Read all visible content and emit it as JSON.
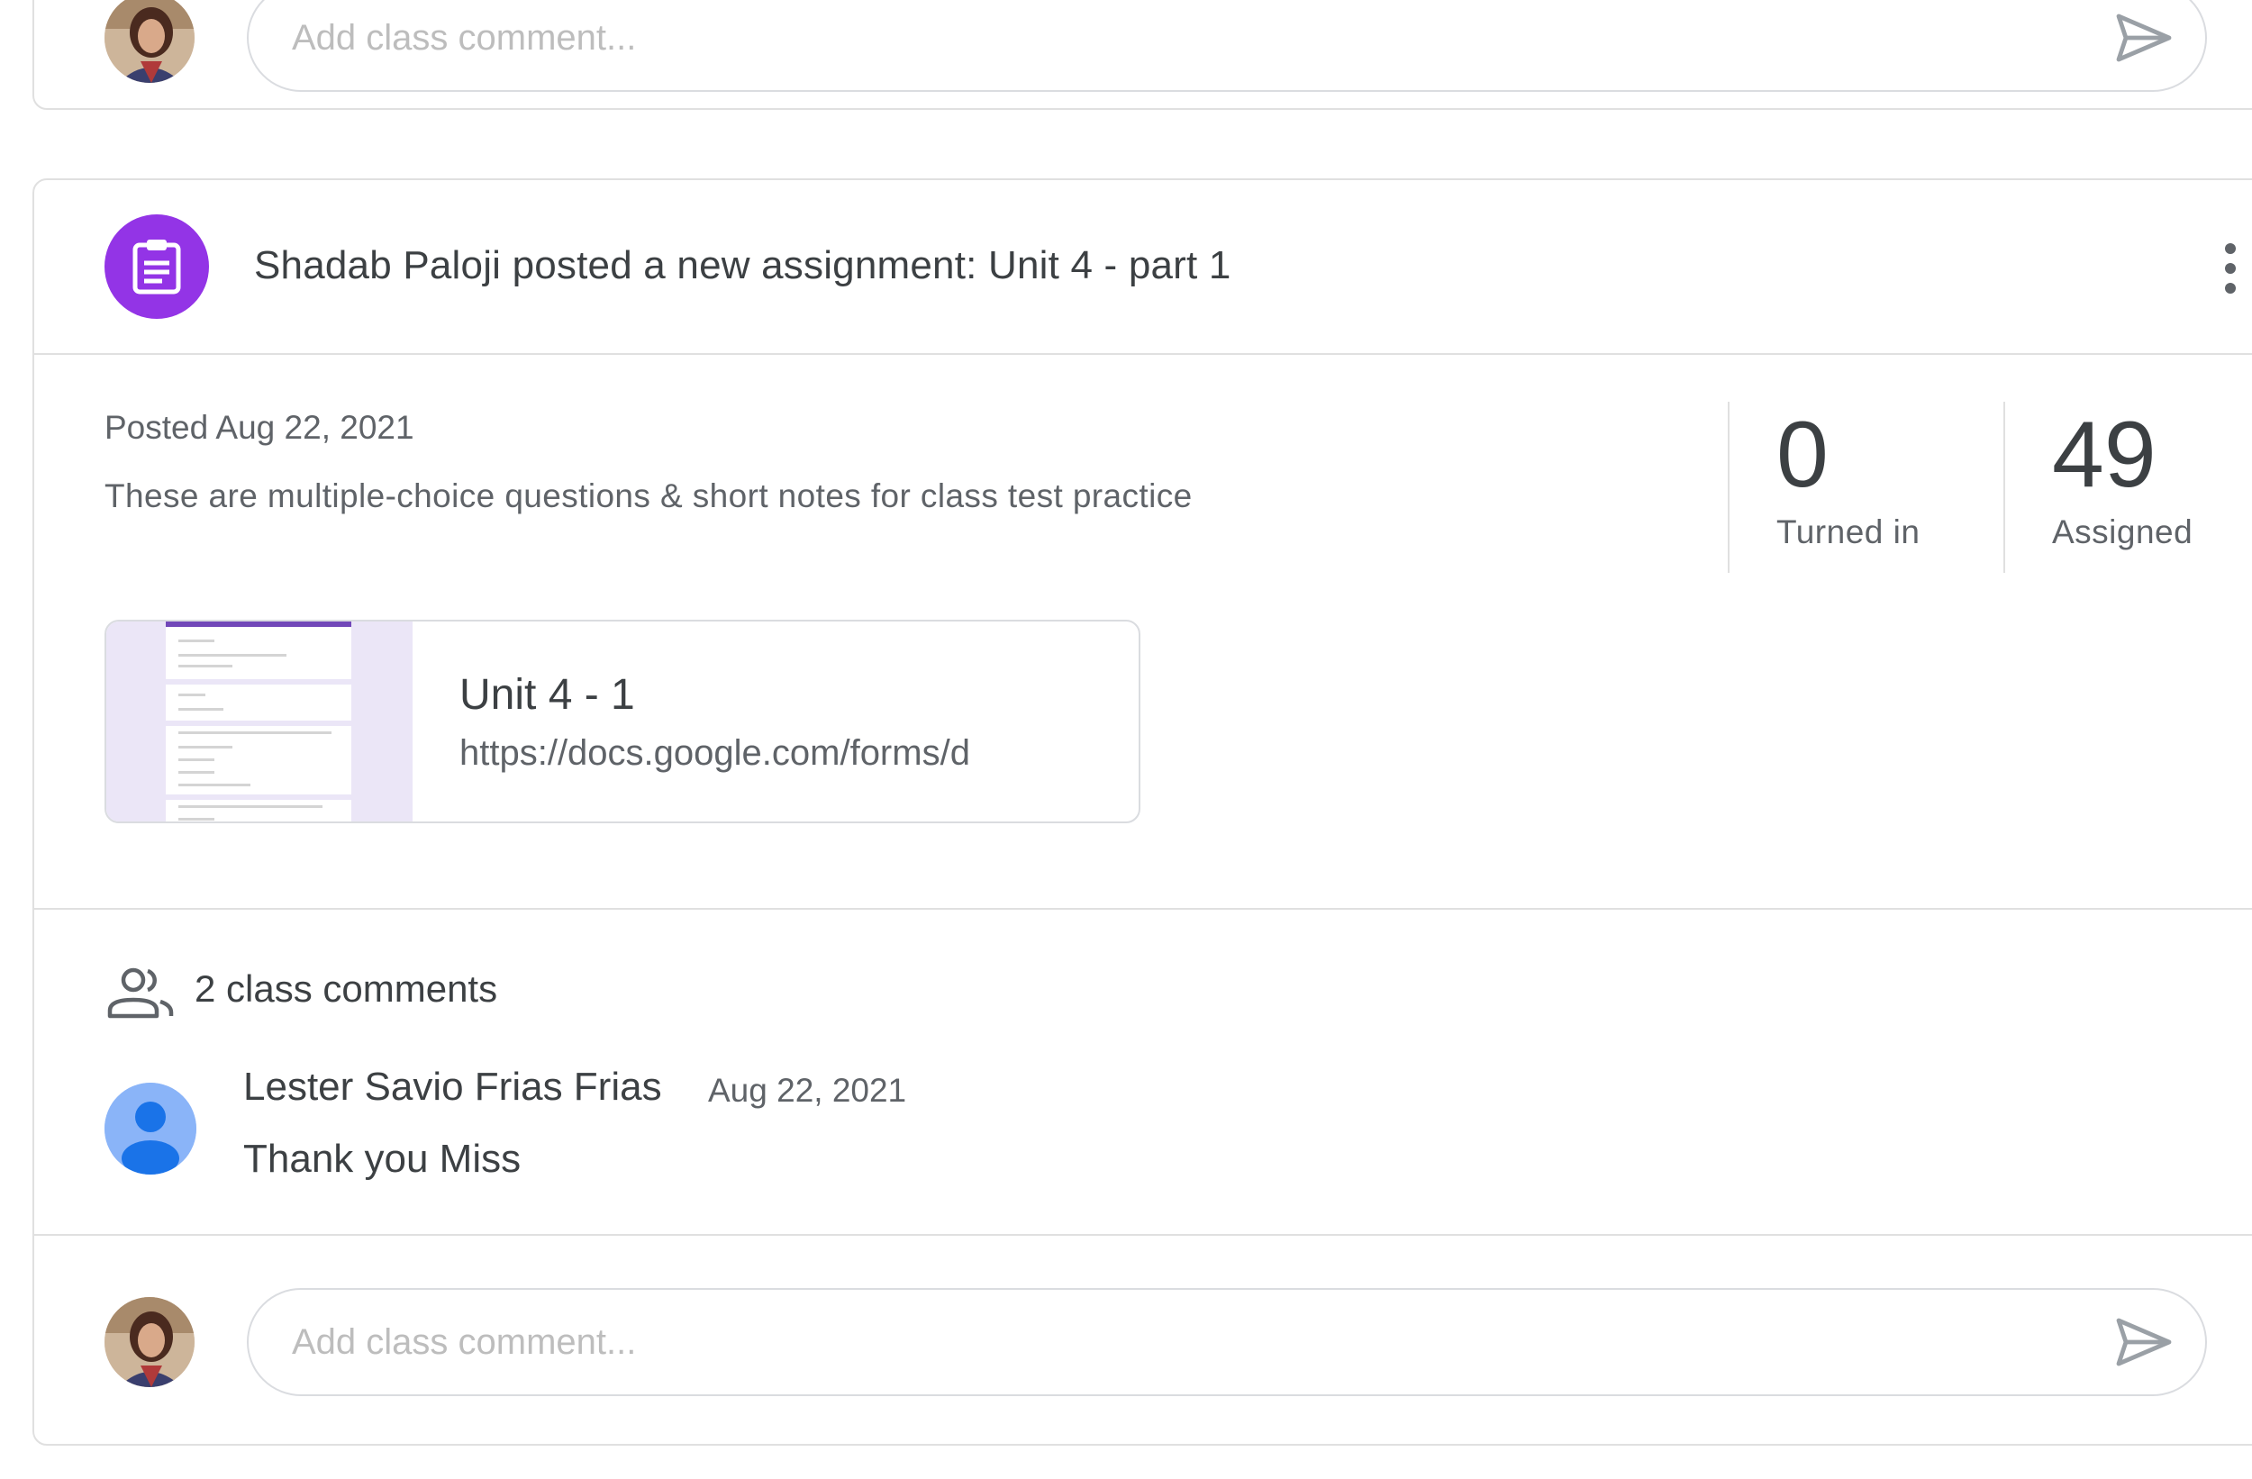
{
  "top_card": {
    "comment_placeholder": "Add class comment..."
  },
  "post": {
    "header_title": "Shadab Paloji posted a new assignment: Unit 4 - part 1",
    "posted_date": "Posted Aug 22, 2021",
    "description": "These are multiple-choice questions & short notes  for class test practice",
    "stats": {
      "turned_in_value": "0",
      "turned_in_label": "Turned in",
      "assigned_value": "49",
      "assigned_label": "Assigned"
    },
    "attachment": {
      "title": "Unit 4 - 1",
      "url": "https://docs.google.com/forms/d"
    },
    "comments": {
      "count_label": "2 class comments",
      "items": [
        {
          "author": "Lester Savio Frias Frias",
          "date": "Aug 22, 2021",
          "text": "Thank you Miss"
        }
      ]
    },
    "comment_placeholder": "Add class comment..."
  },
  "colors": {
    "assignment_icon_bg": "#9334e6",
    "form_accent": "#7248b9",
    "default_avatar": "#8ab4f8"
  },
  "icons": [
    "assignment-icon",
    "more-vert-icon",
    "people-icon",
    "send-icon",
    "user-avatar",
    "default-avatar"
  ]
}
